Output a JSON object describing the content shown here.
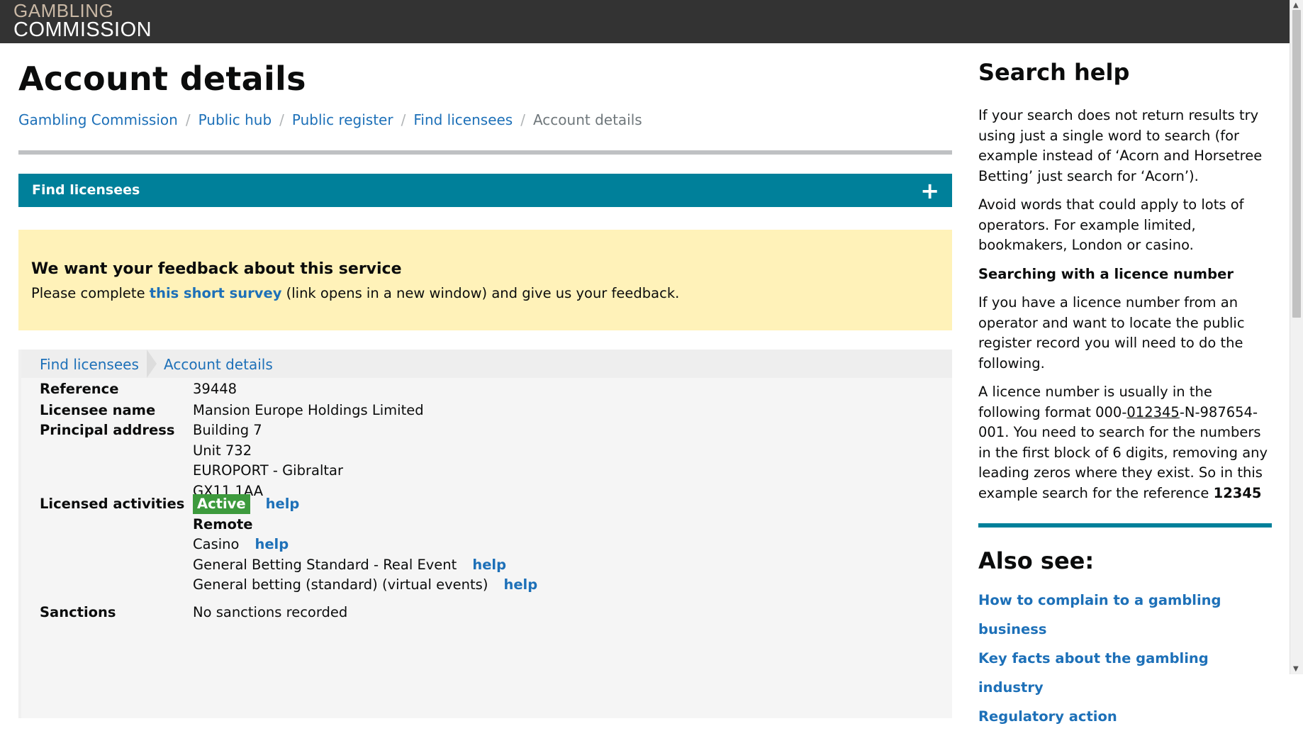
{
  "header": {
    "logo_line1": "GAMBLING",
    "logo_line2": "COMMISSION"
  },
  "page": {
    "title": "Account details",
    "breadcrumbs": [
      "Gambling Commission",
      "Public hub",
      "Public register",
      "Find licensees",
      "Account details"
    ],
    "breadcrumb_separator": "/"
  },
  "accordion": {
    "label": "Find licensees",
    "toggle_icon": "+"
  },
  "feedback": {
    "heading": "We want your feedback about this service",
    "text_before": "Please complete ",
    "link_text": "this short survey",
    "text_after": " (link opens in a new window) and give us your feedback."
  },
  "panel": {
    "tabs": [
      "Find licensees",
      "Account details"
    ],
    "reference_label": "Reference",
    "reference_value": "39448",
    "licensee_label": "Licensee name",
    "licensee_value": "Mansion Europe Holdings Limited",
    "address_label": "Principal address",
    "address_lines": [
      "Building 7",
      "Unit 732",
      "EUROPORT - Gibraltar",
      "GX11 1AA"
    ],
    "activities_label": "Licensed activities",
    "status_badge": "Active",
    "help_label": "help",
    "activity_group": "Remote",
    "activities": [
      "Casino",
      "General Betting Standard - Real Event",
      "General betting (standard) (virtual events)"
    ],
    "sanctions_label": "Sanctions",
    "sanctions_value": "No sanctions recorded"
  },
  "sidebar": {
    "title": "Search help",
    "para1": "If your search does not return results try using just a single word to search (for example instead of ‘Acorn and Horsetree Betting’ just search for ‘Acorn’).",
    "para2": "Avoid words that could apply to lots of operators. For example limited, bookmakers, London or casino.",
    "subheading": "Searching with a licence number",
    "para3": "If you have a licence number from an operator and want to locate the public register record you will need to do the following.",
    "para4_before": "A licence number is usually in the following format 000-",
    "para4_underlined": "012345",
    "para4_middle": "-N-987654-001. You need to search for the numbers in the first block of 6 digits, removing any leading zeros where they exist. So in this example search for the reference ",
    "para4_bold": "12345",
    "also_see": "Also see:",
    "links": [
      "How to complain to a gambling business",
      "Key facts about the gambling industry",
      "Regulatory action"
    ]
  },
  "colors": {
    "header_bg": "#333333",
    "accordion_bg": "#00809a",
    "feedback_bg": "#fff2b9",
    "link": "#1d70b8",
    "active_badge": "#3d9a3d"
  }
}
